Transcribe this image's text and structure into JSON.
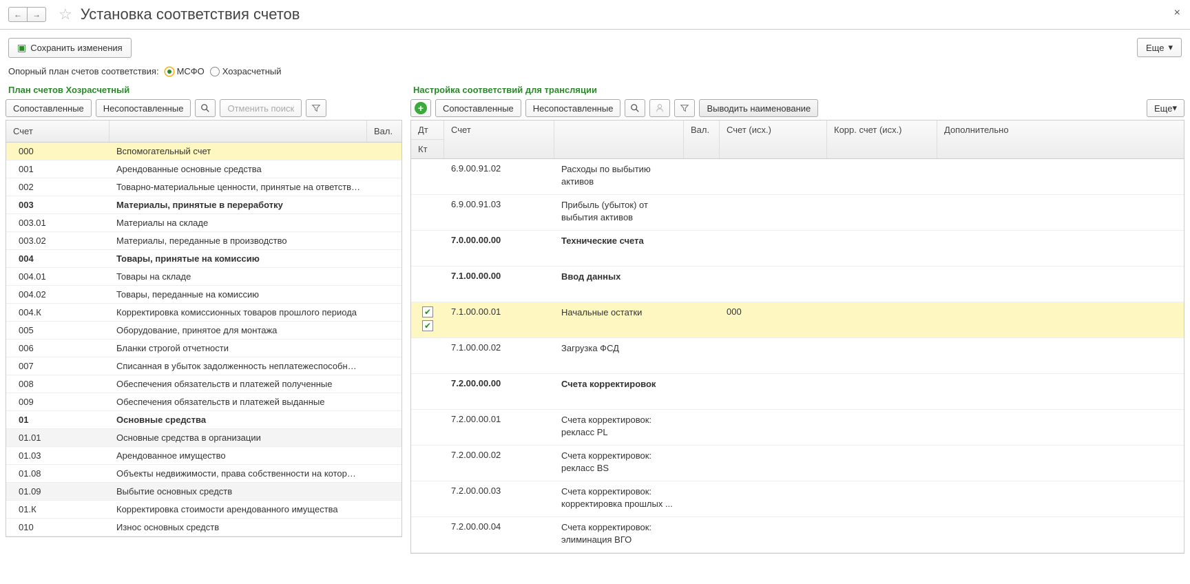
{
  "page": {
    "title": "Установка соответствия счетов",
    "save_btn": "Сохранить изменения",
    "more_btn": "Еще",
    "close": "×"
  },
  "filter": {
    "label": "Опорный план счетов соответствия:",
    "opt1": "МСФО",
    "opt2": "Хозрасчетный"
  },
  "left": {
    "title": "План счетов Хозрасчетный",
    "btn_matched": "Сопоставленные",
    "btn_unmatched": "Несопоставленные",
    "btn_cancel": "Отменить поиск",
    "head_code": "Счет",
    "head_val": "Вал.",
    "rows": [
      {
        "code": "000",
        "name": "Вспомогательный счет",
        "sel": true
      },
      {
        "code": "001",
        "name": "Арендованные основные средства"
      },
      {
        "code": "002",
        "name": "Товарно-материальные ценности, принятые на ответстве..."
      },
      {
        "code": "003",
        "name": "Материалы, принятые в переработку",
        "bold": true
      },
      {
        "code": "003.01",
        "name": "Материалы на складе"
      },
      {
        "code": "003.02",
        "name": "Материалы, переданные в производство"
      },
      {
        "code": "004",
        "name": "Товары, принятые на комиссию",
        "bold": true
      },
      {
        "code": "004.01",
        "name": "Товары на складе"
      },
      {
        "code": "004.02",
        "name": "Товары, переданные на комиссию"
      },
      {
        "code": "004.К",
        "name": "Корректировка комиссионных товаров прошлого периода"
      },
      {
        "code": "005",
        "name": "Оборудование, принятое для монтажа"
      },
      {
        "code": "006",
        "name": "Бланки строгой отчетности"
      },
      {
        "code": "007",
        "name": "Списанная в убыток задолженность неплатежеспособны..."
      },
      {
        "code": "008",
        "name": "Обеспечения обязательств и платежей полученные"
      },
      {
        "code": "009",
        "name": "Обеспечения обязательств и платежей выданные"
      },
      {
        "code": "01",
        "name": "Основные средства",
        "bold": true
      },
      {
        "code": "01.01",
        "name": "Основные средства в организации",
        "gray": true
      },
      {
        "code": "01.03",
        "name": "Арендованное имущество"
      },
      {
        "code": "01.08",
        "name": "Объекты недвижимости, права собственности на которы..."
      },
      {
        "code": "01.09",
        "name": "Выбытие основных средств",
        "gray": true
      },
      {
        "code": "01.К",
        "name": "Корректировка стоимости арендованного имущества"
      },
      {
        "code": "010",
        "name": "Износ основных средств"
      }
    ]
  },
  "right": {
    "title": "Настройка соответствий для трансляции",
    "btn_matched": "Сопоставленные",
    "btn_unmatched": "Несопоставленные",
    "btn_output": "Выводить наименование",
    "more_btn": "Еще",
    "head_dt": "Дт",
    "head_kt": "Кт",
    "head_acct": "Счет",
    "head_val": "Вал.",
    "head_src": "Счет (исх.)",
    "head_corr": "Корр. счет (исх.)",
    "head_extra": "Дополнительно",
    "rows": [
      {
        "acct": "6.9.00.91.02",
        "desc": "Расходы по выбытию активов"
      },
      {
        "acct": "6.9.00.91.03",
        "desc": "Прибыль (убыток) от выбытия активов"
      },
      {
        "acct": "7.0.00.00.00",
        "desc": "Технические счета",
        "bold": true
      },
      {
        "acct": "7.1.00.00.00",
        "desc": "Ввод данных",
        "bold": true
      },
      {
        "acct": "7.1.00.00.01",
        "desc": "Начальные остатки",
        "sel": true,
        "dt": true,
        "kt": true,
        "src": "000"
      },
      {
        "acct": "7.1.00.00.02",
        "desc": "Загрузка ФСД"
      },
      {
        "acct": "7.2.00.00.00",
        "desc": "Счета корректировок",
        "bold": true
      },
      {
        "acct": "7.2.00.00.01",
        "desc": "Счета корректировок: рекласс PL"
      },
      {
        "acct": "7.2.00.00.02",
        "desc": "Счета корректировок: рекласс BS"
      },
      {
        "acct": "7.2.00.00.03",
        "desc": "Счета корректировок: корректировка прошлых ..."
      },
      {
        "acct": "7.2.00.00.04",
        "desc": "Счета корректировок: элиминация ВГО"
      }
    ]
  }
}
